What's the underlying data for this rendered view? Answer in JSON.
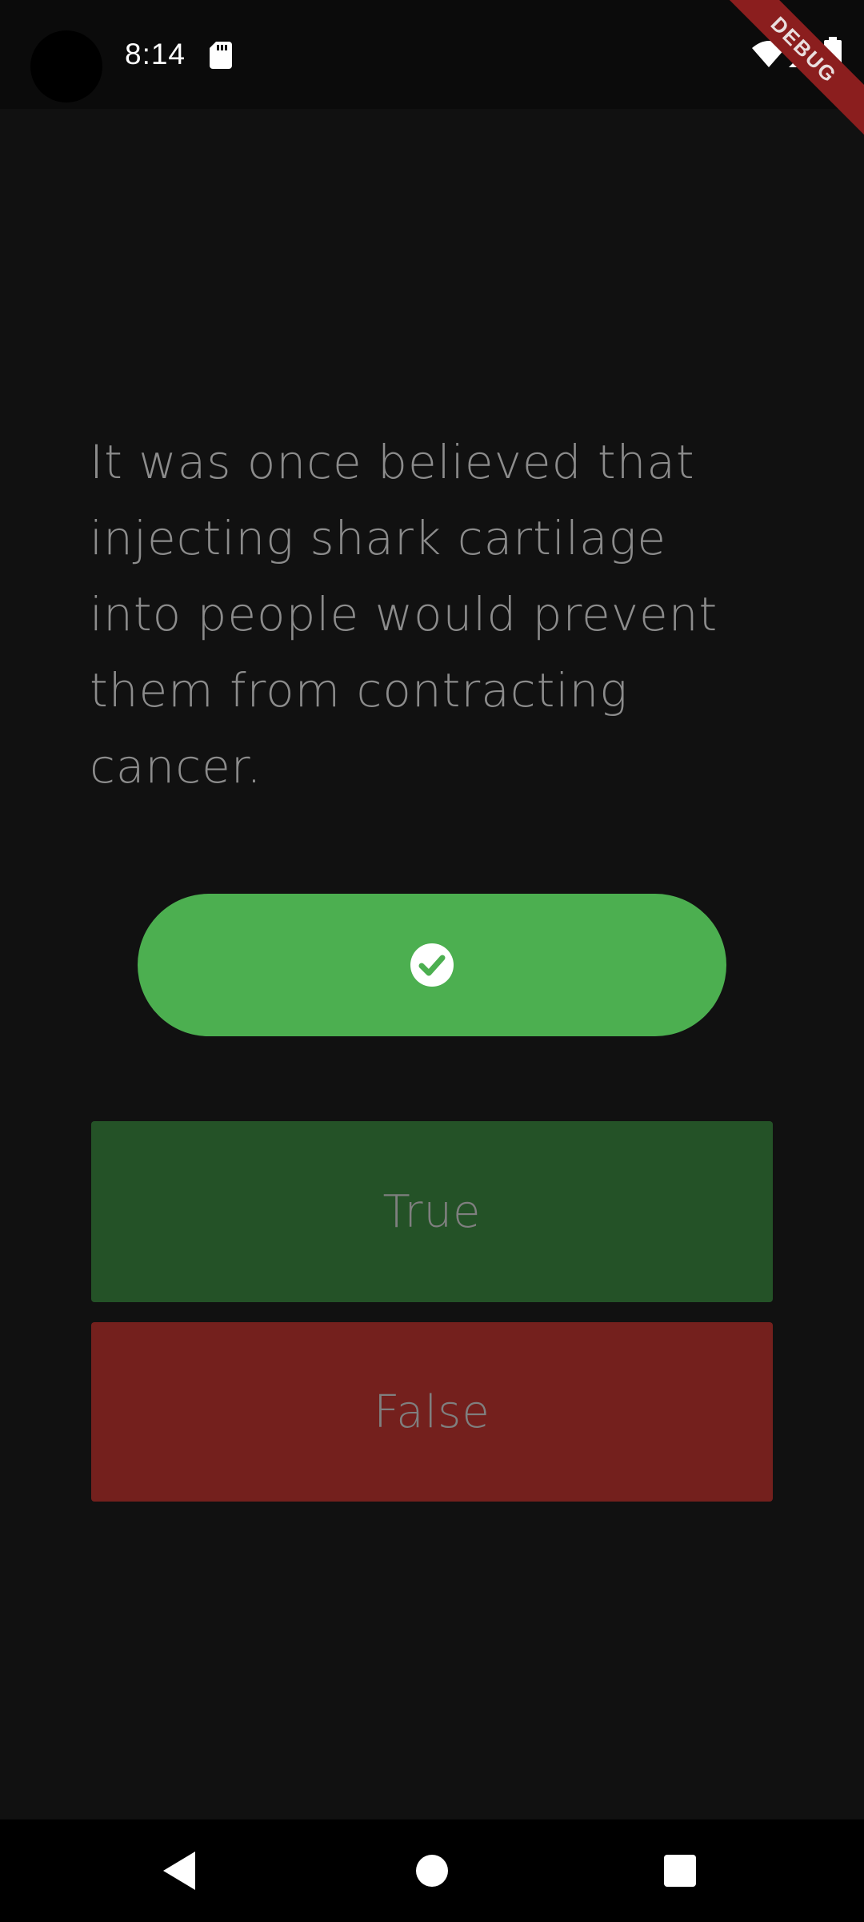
{
  "status_bar": {
    "time": "8:14",
    "debug_banner": "DEBUG"
  },
  "question": {
    "text": "It was once believed that injecting shark cartilage into people would prevent them from contracting cancer."
  },
  "score": {
    "icons": [
      "check-circle-icon"
    ],
    "color": "#4caf50"
  },
  "answers": {
    "true_label": "True",
    "false_label": "False",
    "true_color": "#245227",
    "false_color": "#74201d"
  },
  "nav_bar": {
    "icons": [
      "back-icon",
      "home-icon",
      "recents-icon"
    ]
  }
}
